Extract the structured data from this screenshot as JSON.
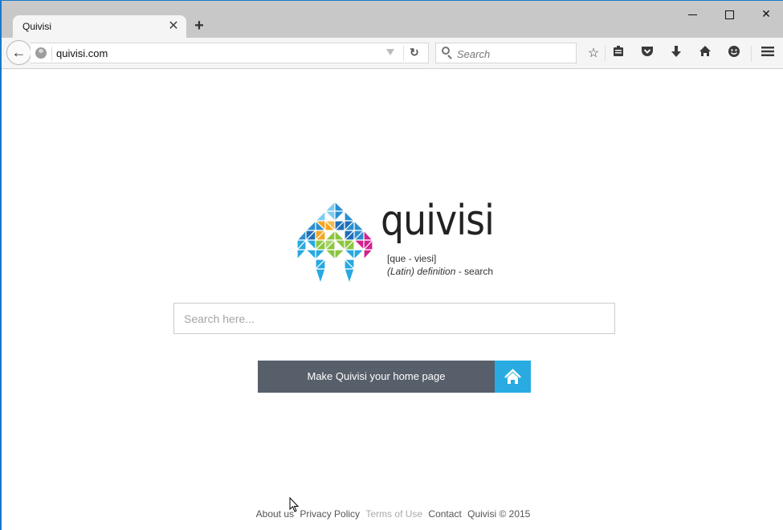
{
  "browser": {
    "tab": {
      "title": "Quivisi"
    },
    "url": "quivisi.com",
    "search_placeholder": "Search",
    "toolbar_icons": [
      "star-icon",
      "reading-list-icon",
      "pocket-icon",
      "download-icon",
      "home-icon",
      "hello-icon",
      "menu-icon"
    ]
  },
  "page": {
    "brand": {
      "name": "quivisi",
      "pronunciation": "[que - viesi]",
      "definition_italic": "(Latin) definition",
      "definition_rest": " -  search",
      "logo_colors": [
        "#7ccbf0",
        "#2a8fd0",
        "#1f6fb8",
        "#f5a623",
        "#8cc63f",
        "#d4218f",
        "#27a9e1"
      ]
    },
    "search": {
      "placeholder": "Search here..."
    },
    "homepage_button": {
      "label": "Make Quivisi your home page",
      "accent": "#29abe2",
      "bg": "#575f6b"
    },
    "footer": {
      "links": [
        {
          "label": "About us"
        },
        {
          "label": "Privacy Policy"
        },
        {
          "label": "Terms of Use"
        },
        {
          "label": "Contact"
        }
      ],
      "copyright": "Quivisi © 2015"
    }
  }
}
